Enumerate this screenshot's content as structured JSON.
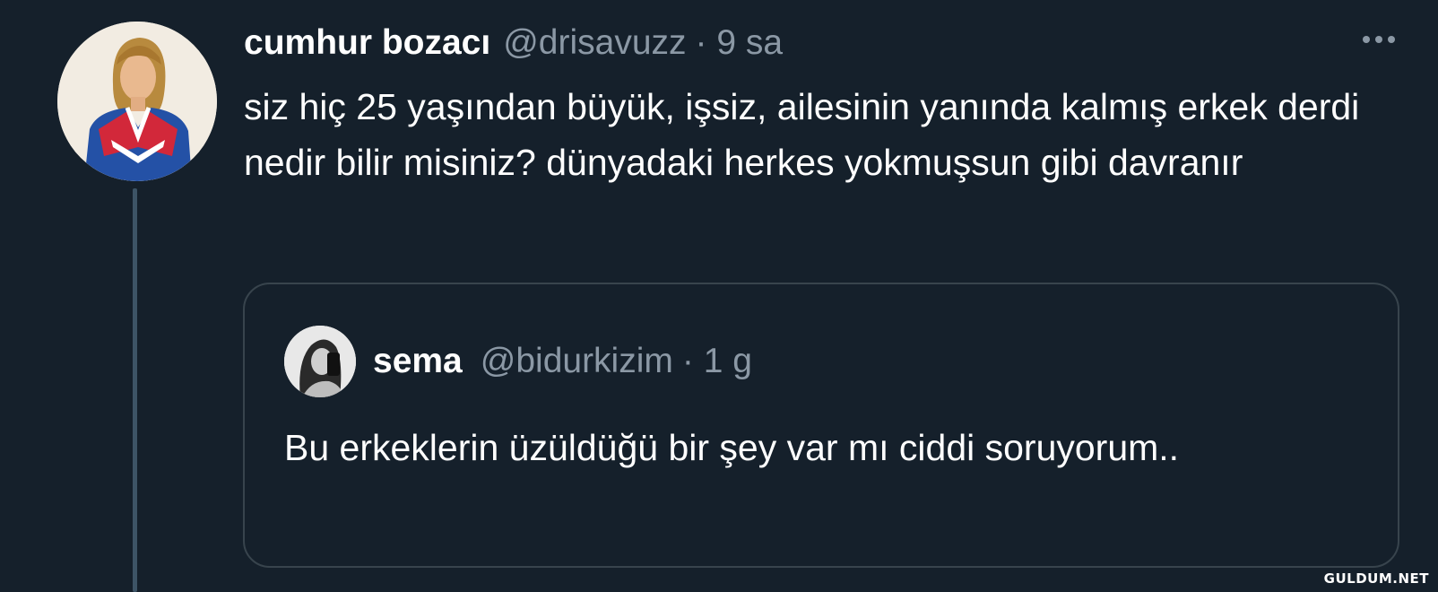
{
  "tweet": {
    "author_name": "cumhur bozacı",
    "handle": "@drisavuzz",
    "time": "· 9 sa",
    "text": "siz hiç 25 yaşından büyük, işsiz, ailesinin yanında kalmış erkek derdi nedir bilir misiniz? dünyadaki herkes yokmuşsun gibi davranır",
    "more_icon": "more-horizontal-icon"
  },
  "quoted_tweet": {
    "author_name": "sema",
    "handle": "@bidurkizim",
    "time": "· 1 g",
    "text": "Bu erkeklerin üzüldüğü bir şey var mı ciddi soruyorum.."
  },
  "watermark": "GULDUM.NET",
  "colors": {
    "background": "#15202b",
    "text_primary": "#ffffff",
    "text_secondary": "#8b98a5",
    "border": "#38444d",
    "thread_line": "#3d5466"
  }
}
